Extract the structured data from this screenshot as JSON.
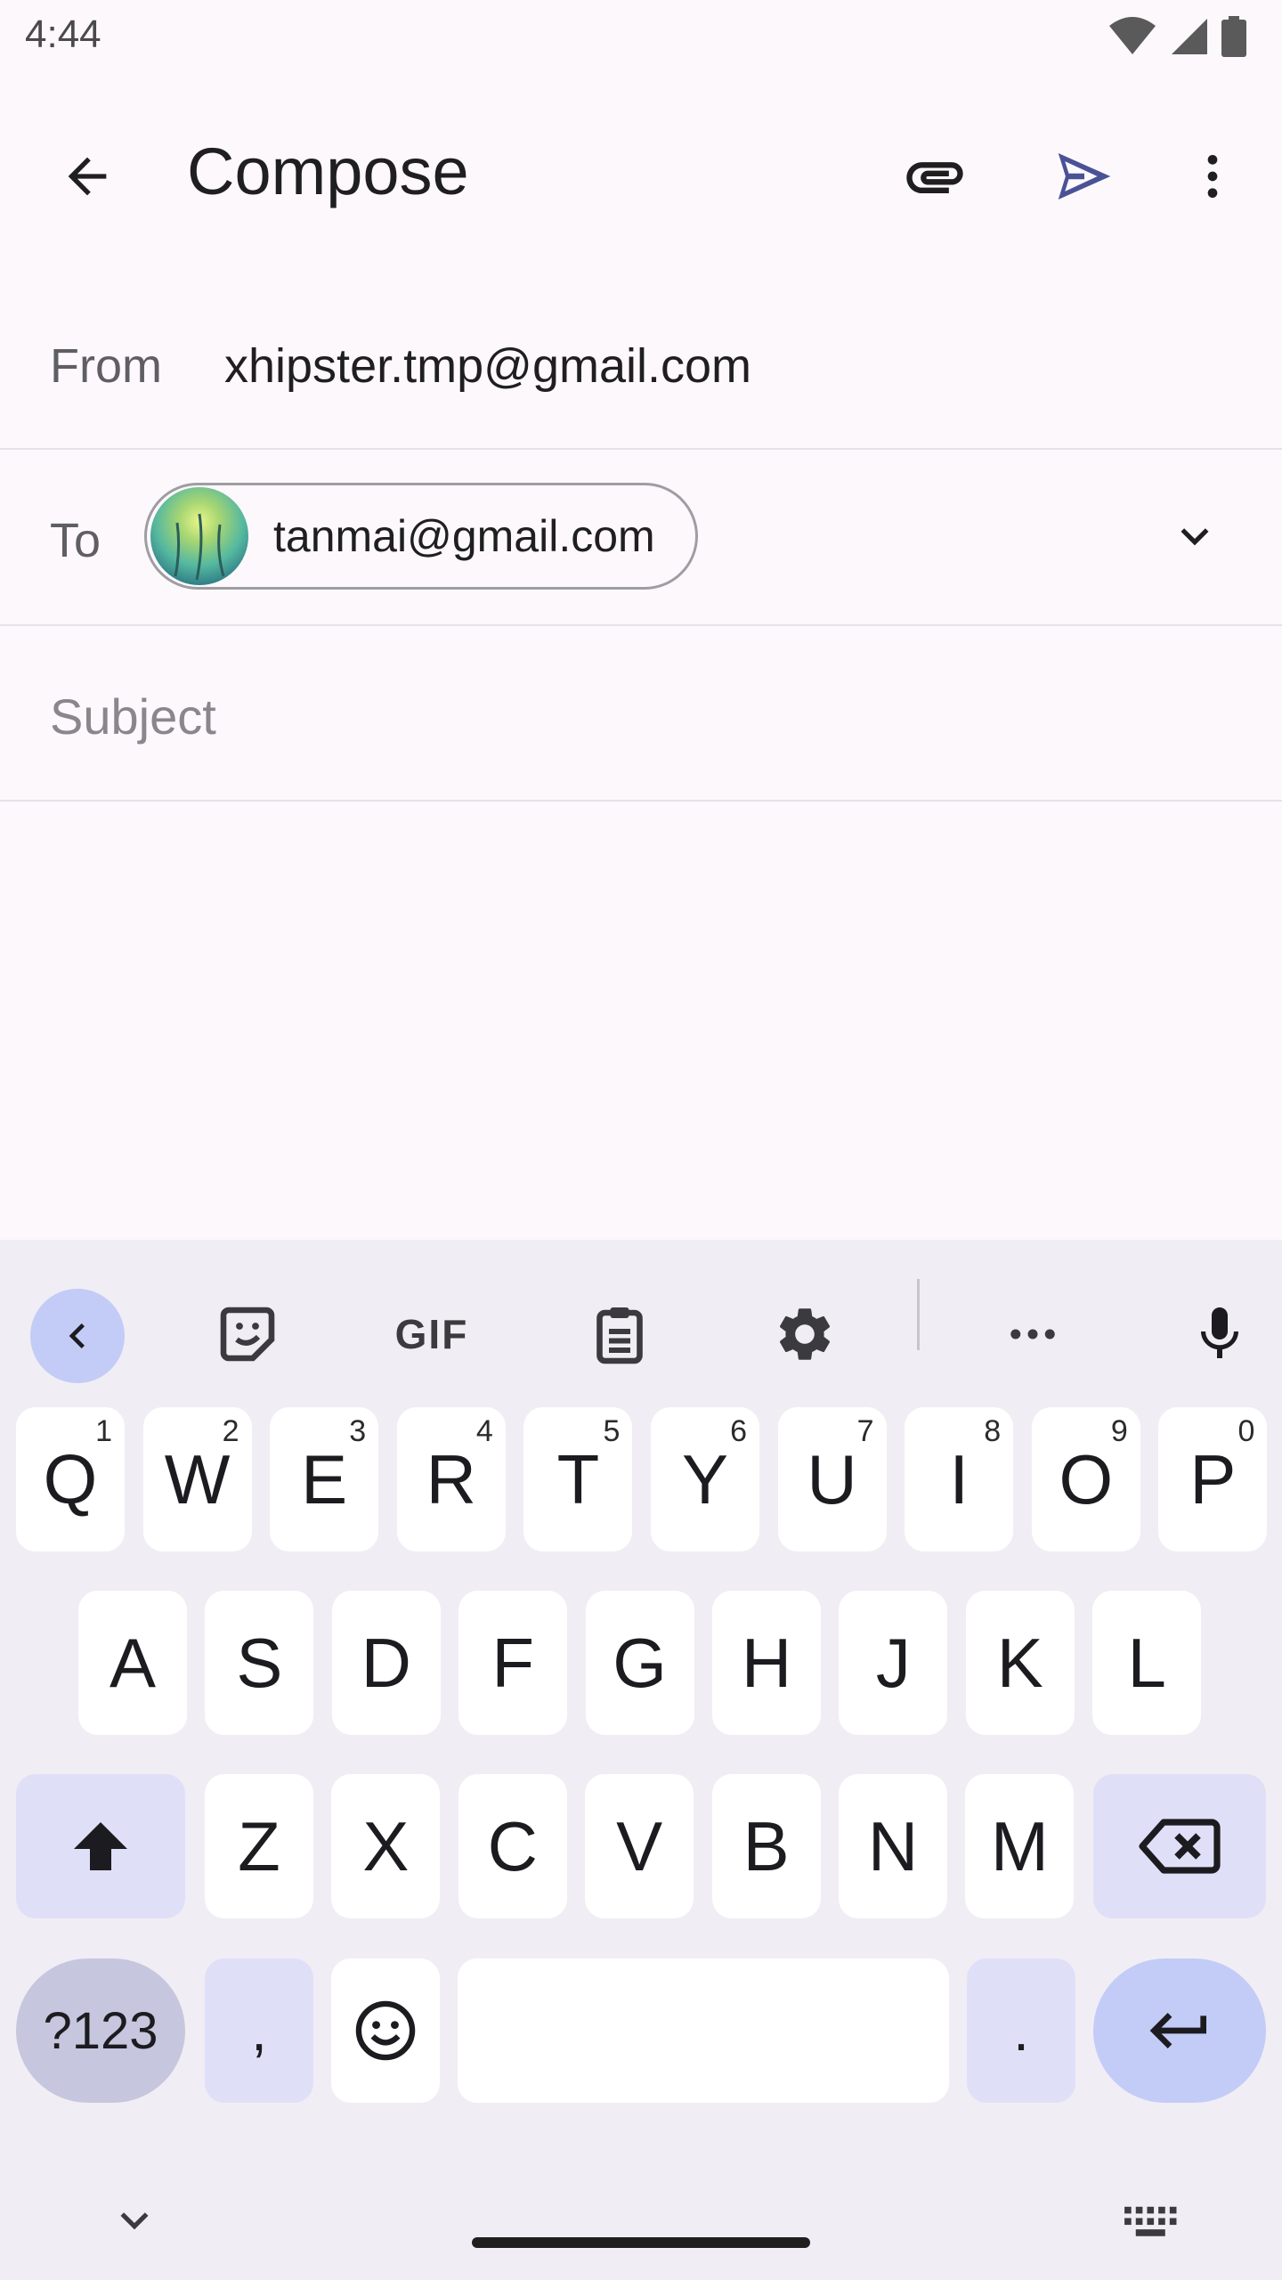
{
  "status_bar": {
    "time": "4:44"
  },
  "app_bar": {
    "title": "Compose",
    "icons": {
      "back": "back-arrow-icon",
      "attach": "paperclip-icon",
      "send": "send-icon",
      "more": "more-vert-icon"
    }
  },
  "compose": {
    "from_label": "From",
    "from_value": "xhipster.tmp@gmail.com",
    "to_label": "To",
    "to_recipient": "tanmai@gmail.com",
    "subject_placeholder": "Subject"
  },
  "keyboard": {
    "toolbar": [
      "chevron-left-icon",
      "sticker-icon",
      "GIF",
      "clipboard-icon",
      "settings-icon",
      "more-horiz-icon",
      "mic-icon"
    ],
    "gif_label": "GIF",
    "row1": [
      {
        "k": "Q",
        "h": "1"
      },
      {
        "k": "W",
        "h": "2"
      },
      {
        "k": "E",
        "h": "3"
      },
      {
        "k": "R",
        "h": "4"
      },
      {
        "k": "T",
        "h": "5"
      },
      {
        "k": "Y",
        "h": "6"
      },
      {
        "k": "U",
        "h": "7"
      },
      {
        "k": "I",
        "h": "8"
      },
      {
        "k": "O",
        "h": "9"
      },
      {
        "k": "P",
        "h": "0"
      }
    ],
    "row2": [
      "A",
      "S",
      "D",
      "F",
      "G",
      "H",
      "J",
      "K",
      "L"
    ],
    "row3": [
      "Z",
      "X",
      "C",
      "V",
      "B",
      "N",
      "M"
    ],
    "symbols_label": "?123",
    "comma_label": ",",
    "period_label": ".",
    "colors": {
      "accent": "#c2ccf7",
      "fn_key": "#dfe0f8",
      "send": "#4a5296"
    }
  }
}
